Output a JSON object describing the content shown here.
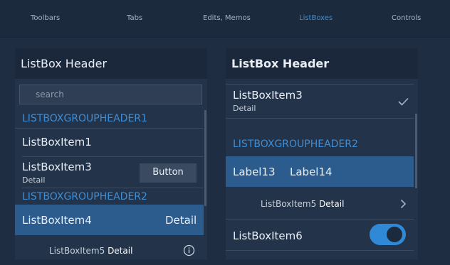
{
  "tabs": [
    {
      "label": "Toolbars"
    },
    {
      "label": "Tabs"
    },
    {
      "label": "Edits, Memos"
    },
    {
      "label": "ListBoxes"
    },
    {
      "label": "Controls"
    }
  ],
  "accent_color": "#3d8ed7",
  "left": {
    "header": "ListBox Header",
    "search_placeholder": "search",
    "group1": "LISTBOXGROUPHEADER1",
    "item1": "ListBoxItem1",
    "item3": "ListBoxItem3",
    "item3_detail": "Detail",
    "button": "Button",
    "group2": "LISTBOXGROUPHEADER2",
    "item4": "ListBoxItem4",
    "item4_detail": "Detail",
    "item5": "ListBoxItem5",
    "item5_detail": "Detail",
    "info_icon": "info-icon"
  },
  "right": {
    "header": "ListBox Header",
    "item3": "ListBoxItem3",
    "item3_detail": "Detail",
    "check_icon": "check-icon",
    "group2": "LISTBOXGROUPHEADER2",
    "label13": "Label13",
    "label14": "Label14",
    "item5": "ListBoxItem5",
    "item5_detail": "Detail",
    "chevron_icon": "chevron-right-icon",
    "item6": "ListBoxItem6",
    "toggle_on": true
  }
}
